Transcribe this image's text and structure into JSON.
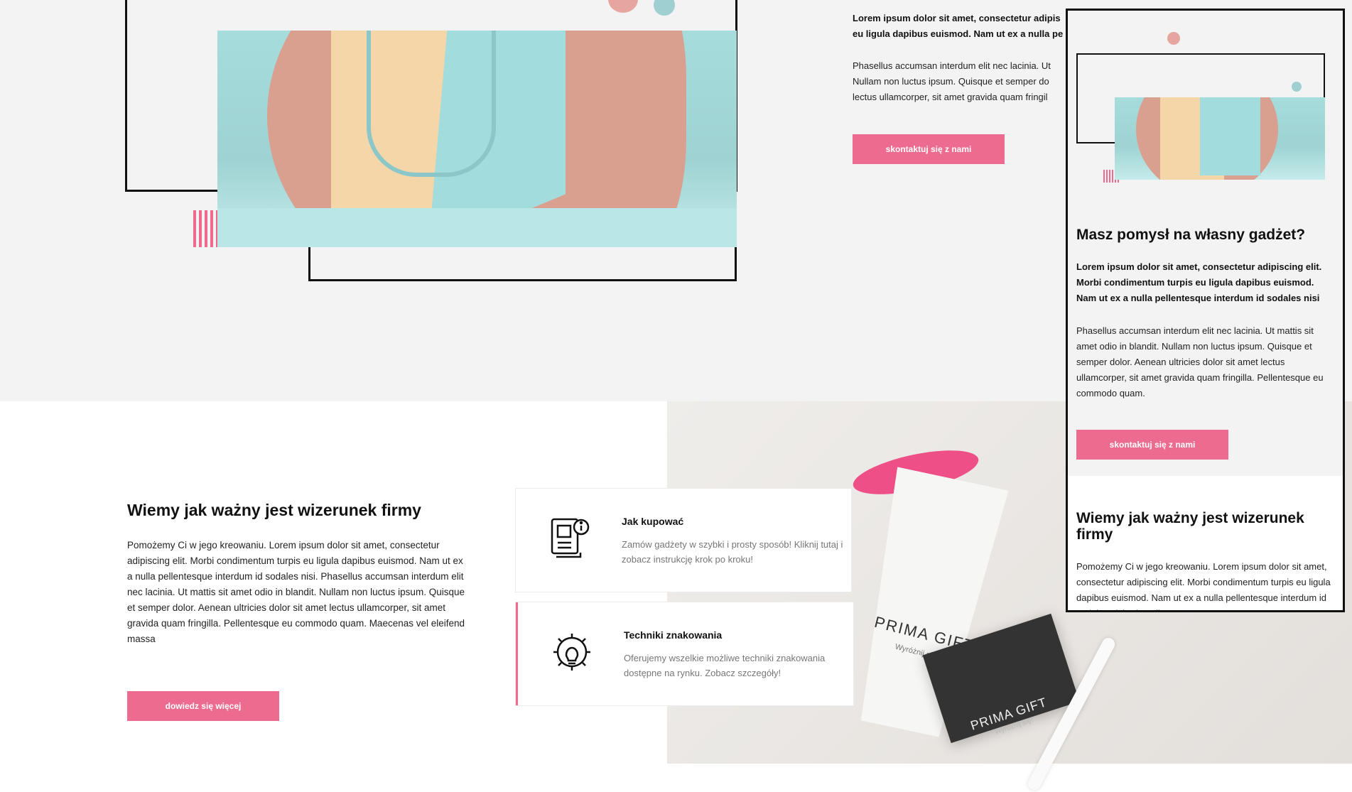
{
  "hero": {
    "lead": "Lorem ipsum dolor sit amet, consectetur adipiscing elit. Morbi condimentum turpis eu ligula dapibus euismod. Nam ut ex a nulla pellentesque interdum id sodales nisi",
    "lead_line1": "Lorem ipsum dolor sit amet, consectetur adipis",
    "lead_line2": "eu ligula dapibus euismod. Nam ut ex a nulla pe",
    "para_line1": "Phasellus accumsan interdum elit nec lacinia. Ut",
    "para_line2": "Nullam non luctus ipsum. Quisque et semper do",
    "para_line3": "lectus ullamcorper, sit amet gravida quam fringil",
    "cta": "skontaktuj się z nami"
  },
  "brand": {
    "title": "Wiemy jak ważny jest wizerunek firmy",
    "body": "Pomożemy Ci w jego kreowaniu. Lorem ipsum dolor sit amet, consectetur adipiscing elit. Morbi condimentum turpis eu ligula dapibus euismod. Nam ut ex a nulla pellentesque interdum id sodales nisi. Phasellus accumsan interdum elit nec lacinia. Ut mattis sit amet odio in blandit. Nullam non luctus ipsum. Quisque et semper dolor. Aenean ultricies dolor sit amet lectus ullamcorper, sit amet gravida quam fringilla. Pellentesque eu commodo quam. Maecenas vel eleifend massa",
    "cta": "dowiedz się więcej"
  },
  "cards": [
    {
      "title": "Jak kupować",
      "text": "Zamów gadżety w szybki i prosty sposób! Kliknij tutaj i zobacz instrukcję krok po kroku!",
      "icon": "document-info-icon"
    },
    {
      "title": "Techniki znakowania",
      "text": "Oferujemy wszelkie możliwe techniki znakowania dostępne na rynku. Zobacz szczegóły!",
      "icon": "gear-bulb-icon"
    }
  ],
  "product": {
    "brand_name": "PRIMA GIFT",
    "tagline": "Wyróżnij się!"
  },
  "mobile": {
    "heading": "Masz pomysł na własny gadżet?",
    "lead": "Lorem ipsum dolor sit amet, consectetur adipiscing elit. Morbi condimentum turpis eu ligula dapibus euismod. Nam ut ex a nulla pellentesque interdum id sodales nisi",
    "para": "Phasellus accumsan interdum elit nec lacinia. Ut mattis sit amet odio in blandit. Nullam non luctus ipsum. Quisque et semper dolor. Aenean ultricies dolor sit amet lectus ullamcorper, sit amet gravida quam fringilla. Pellentesque eu commodo quam.",
    "cta": "skontaktuj się z nami",
    "heading2": "Wiemy jak ważny jest wizerunek firmy",
    "body2": "Pomożemy Ci w jego kreowaniu. Lorem ipsum dolor sit amet, consectetur adipiscing elit. Morbi condimentum turpis eu ligula dapibus euismod. Nam ut ex a nulla pellentesque interdum id sodales nisi. Phasellus"
  },
  "colors": {
    "accent": "#ec6b8f",
    "teal": "#a6dcdc",
    "peach": "#d89a8a",
    "sand": "#f3d7ac"
  }
}
